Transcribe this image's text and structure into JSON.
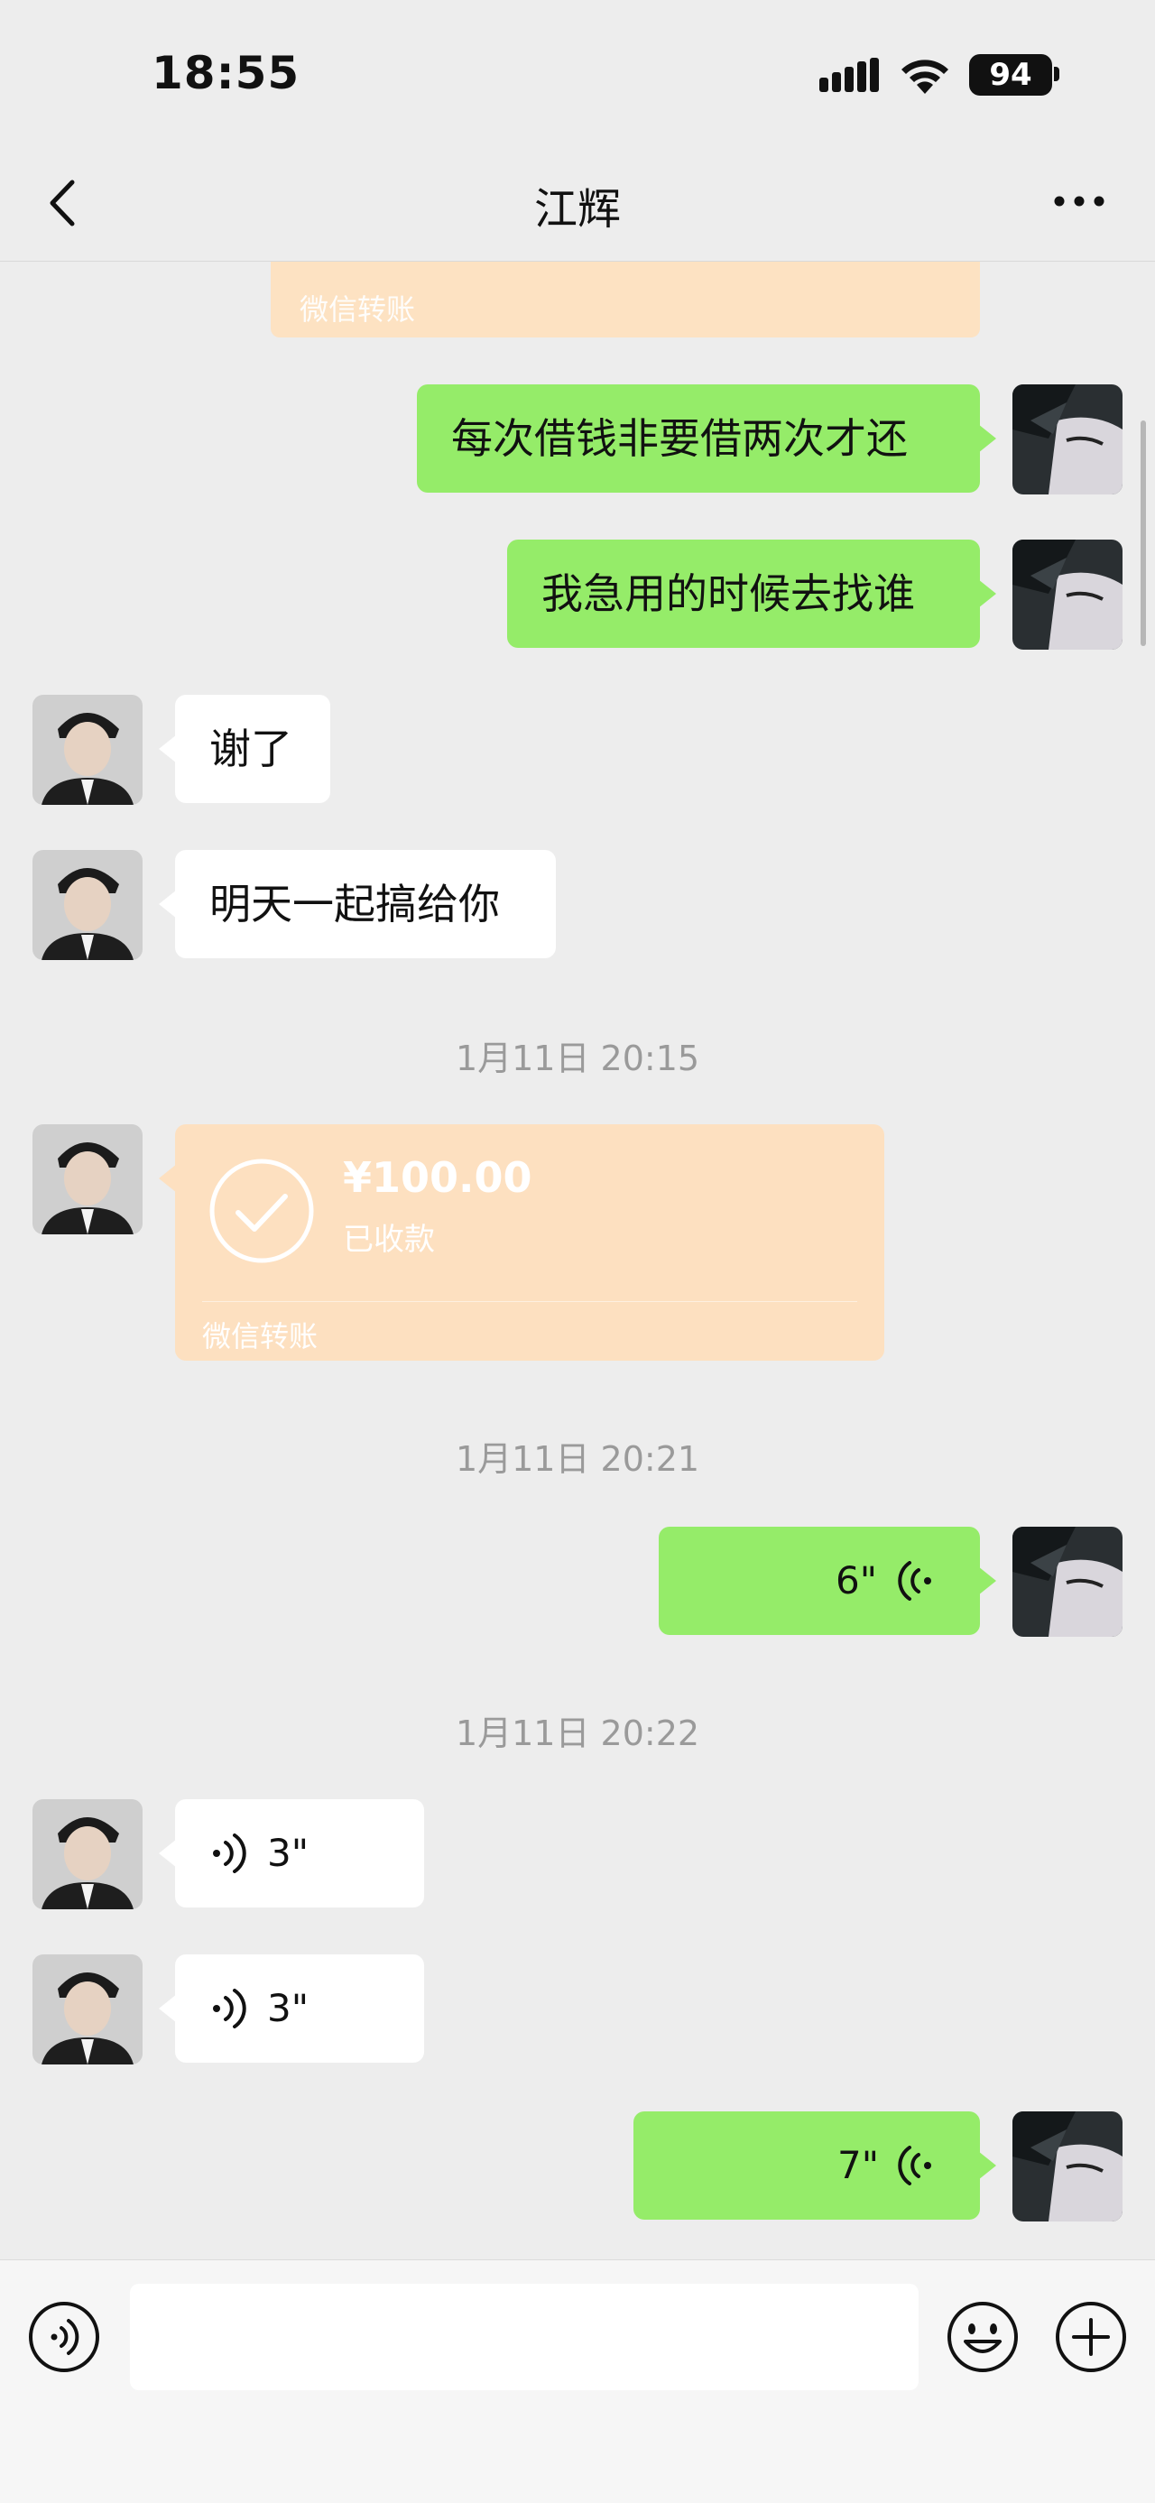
{
  "status_bar": {
    "time": "18:55",
    "battery": "94"
  },
  "nav": {
    "title": "江辉"
  },
  "partial_transfer": {
    "label": "微信转账"
  },
  "messages": [
    {
      "side": "right",
      "type": "text",
      "text": "每次借钱非要借两次才还"
    },
    {
      "side": "right",
      "type": "text",
      "text": "我急用的时候去找谁"
    },
    {
      "side": "left",
      "type": "text",
      "text": "谢了"
    },
    {
      "side": "left",
      "type": "text",
      "text": "明天一起搞给你"
    }
  ],
  "timestamps": [
    "1月11日 20:15",
    "1月11日 20:21",
    "1月11日 20:22"
  ],
  "transfer": {
    "amount": "¥100.00",
    "status": "已收款",
    "label": "微信转账"
  },
  "voices": [
    {
      "side": "right",
      "duration": "6\""
    },
    {
      "side": "left",
      "duration": "3\""
    },
    {
      "side": "left",
      "duration": "3\""
    },
    {
      "side": "right",
      "duration": "7\""
    }
  ],
  "input": {
    "value": ""
  },
  "colors": {
    "sent_bubble": "#95ec69",
    "received_bubble": "#ffffff",
    "transfer_card": "#fde0c0",
    "background": "#ededed"
  },
  "icons": {
    "back": "chevron-left-icon",
    "more": "ellipsis-icon",
    "voice": "voice-wave-icon",
    "emoji": "smiley-icon",
    "plus": "plus-circle-icon",
    "transfer": "check-circle-icon"
  }
}
